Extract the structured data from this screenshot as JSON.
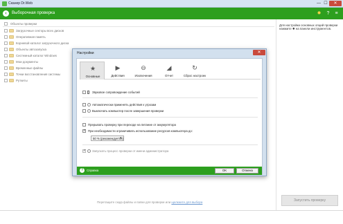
{
  "window": {
    "title": "Сканер Dr.Web",
    "minimize": "—",
    "maximize": "☐",
    "close": "✕"
  },
  "header": {
    "title": "Выборочная проверка",
    "back_icon": "‹",
    "gear_icon": "✹",
    "help_icon": "?",
    "menu_icon": "≡"
  },
  "tree": {
    "root_label": "Объекты проверки",
    "items": [
      {
        "label": "Загрузочные секторы всех дисков"
      },
      {
        "label": "Оперативная память"
      },
      {
        "label": "Корневой каталог загрузочного диска"
      },
      {
        "label": "Объекты автозапуска"
      },
      {
        "label": "Системный каталог Windows"
      },
      {
        "label": "Мои документы"
      },
      {
        "label": "Временные файлы"
      },
      {
        "label": "Точки восстановления системы"
      },
      {
        "label": "Руткиты"
      }
    ]
  },
  "hint": {
    "text": "Для настройки основных опций проверки нажмите ✹ на панели инструментов."
  },
  "footer": {
    "text": "Перетащите сюда файлы и папки для проверки или ",
    "link": "щелкните для выбора"
  },
  "start_button": "Запустить проверку",
  "dialog": {
    "title": "Настройки",
    "close": "✕",
    "tabs": [
      {
        "label": "Основные",
        "icon": "★",
        "active": true
      },
      {
        "label": "Действия",
        "icon": "▶"
      },
      {
        "label": "Исключения",
        "icon": "⊖"
      },
      {
        "label": "Отчет",
        "icon": "◢"
      },
      {
        "label": "Сброс настроек",
        "icon": "↻"
      }
    ],
    "options": {
      "sound": "Звуковое сопровождение событий",
      "auto_actions": "Автоматически применять действия к угрозам",
      "shutdown": "Выключать компьютер после завершения проверки",
      "interrupt_battery": "Прерывать проверку при переходе на питание от аккумулятора",
      "limit_resources": "При необходимости ограничивать использование ресурсов компьютера до:",
      "run_as_admin": "Запускать процесс проверки от имени администратора"
    },
    "resource_select": "50 % (рекомендуется)",
    "help_label": "Справка",
    "ok_label": "OK",
    "cancel_label": "Отмена"
  },
  "colors": {
    "accent_green": "#2d9f1e",
    "title_bar": "#d6e4f3",
    "close_red": "#c94a3c"
  }
}
